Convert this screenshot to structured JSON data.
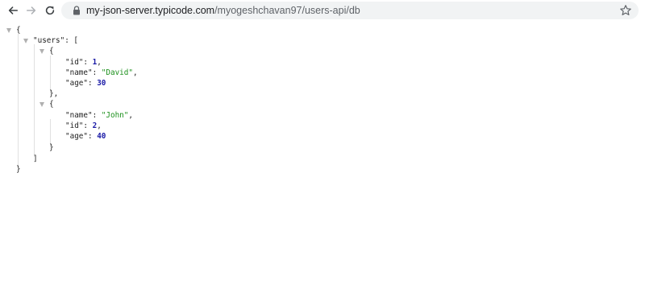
{
  "browser": {
    "url_host": "my-json-server.typicode.com",
    "url_path": "/myogeshchavan97/users-api/db"
  },
  "json": {
    "open_root": "{",
    "users_key": "\"users\"",
    "colon": ": ",
    "open_array": "[",
    "obj1_open": "{",
    "obj1": [
      {
        "key": "\"id\"",
        "value": "1",
        "type": "num",
        "comma": ","
      },
      {
        "key": "\"name\"",
        "value": "\"David\"",
        "type": "str",
        "comma": ","
      },
      {
        "key": "\"age\"",
        "value": "30",
        "type": "num",
        "comma": ""
      }
    ],
    "obj1_close": "},",
    "obj2_open": "{",
    "obj2": [
      {
        "key": "\"name\"",
        "value": "\"John\"",
        "type": "str",
        "comma": ","
      },
      {
        "key": "\"id\"",
        "value": "2",
        "type": "num",
        "comma": ","
      },
      {
        "key": "\"age\"",
        "value": "40",
        "type": "num",
        "comma": ""
      }
    ],
    "obj2_close": "}",
    "close_array": "]",
    "close_root": "}"
  }
}
